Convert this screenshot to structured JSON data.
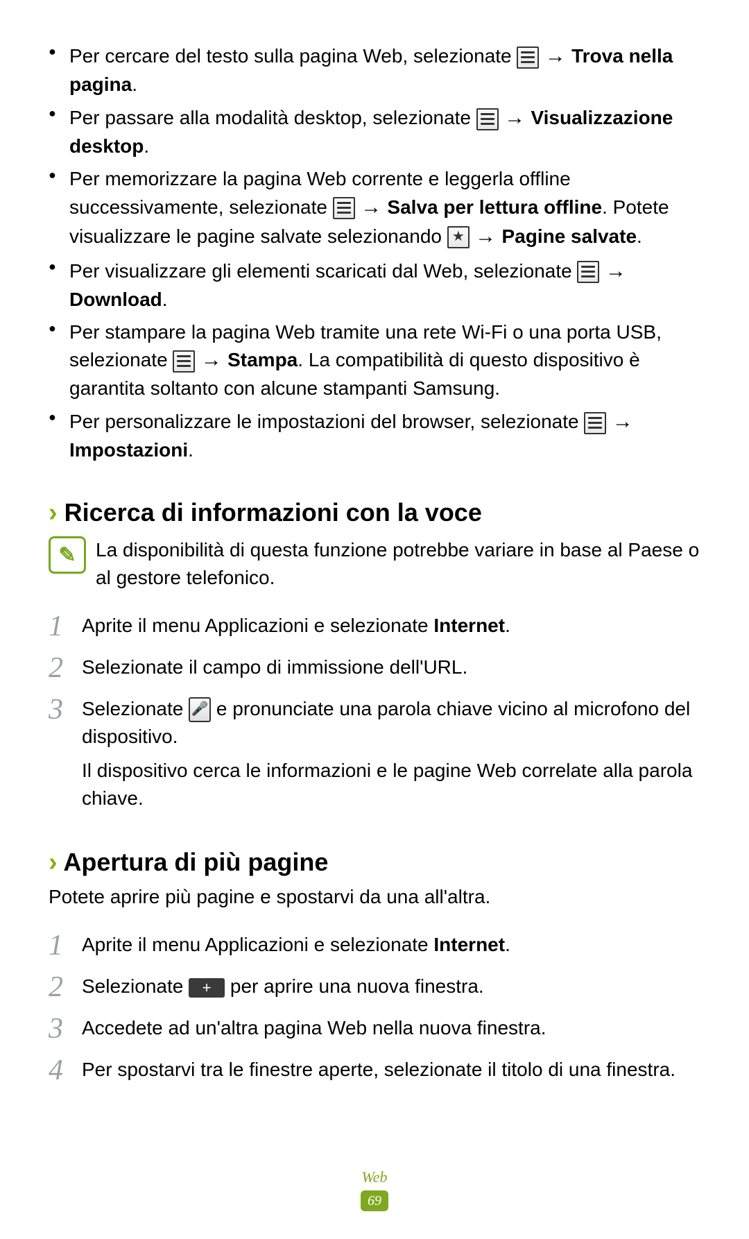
{
  "bullets": [
    {
      "pre": "Per cercare del testo sulla pagina Web, selezionate ",
      "icon1": "menu",
      "mid": " → ",
      "bold": "Trova nella pagina",
      "post": "."
    },
    {
      "pre": "Per passare alla modalità desktop, selezionate ",
      "icon1": "menu",
      "mid": " → ",
      "bold": "Visualizzazione desktop",
      "post": "."
    },
    {
      "pre": "Per memorizzare la pagina Web corrente e leggerla offline successivamente, selezionate ",
      "icon1": "menu",
      "mid": " → ",
      "bold": "Salva per lettura offline",
      "post": ". Potete visualizzare le pagine salvate selezionando ",
      "icon2": "star",
      "mid2": " → ",
      "bold2": "Pagine salvate",
      "post2": "."
    },
    {
      "pre": "Per visualizzare gli elementi scaricati dal Web, selezionate ",
      "icon1": "menu",
      "mid": " → ",
      "bold": "Download",
      "post": "."
    },
    {
      "pre": "Per stampare la pagina Web tramite una rete Wi-Fi o una porta USB, selezionate ",
      "icon1": "menu",
      "mid": " → ",
      "bold": "Stampa",
      "post": ". La compatibilità di questo dispositivo è garantita soltanto con alcune stampanti Samsung."
    },
    {
      "pre": "Per personalizzare le impostazioni del browser, selezionate ",
      "icon1": "menu",
      "mid": " → ",
      "bold": "Impostazioni",
      "post": "."
    }
  ],
  "section1": {
    "title": "Ricerca di informazioni con la voce",
    "note": "La disponibilità di questa funzione potrebbe variare in base al Paese o al gestore telefonico.",
    "steps": [
      {
        "num": "1",
        "pre": "Aprite il menu Applicazioni e selezionate ",
        "bold": "Internet",
        "post": "."
      },
      {
        "num": "2",
        "pre": "Selezionate il campo di immissione dell'URL."
      },
      {
        "num": "3",
        "pre": "Selezionate ",
        "icon": "mic",
        "post": " e pronunciate una parola chiave vicino al microfono del dispositivo.",
        "sub": "Il dispositivo cerca le informazioni e le pagine Web correlate alla parola chiave."
      }
    ]
  },
  "section2": {
    "title": "Apertura di più pagine",
    "intro": "Potete aprire più pagine e spostarvi da una all'altra.",
    "steps": [
      {
        "num": "1",
        "pre": "Aprite il menu Applicazioni e selezionate ",
        "bold": "Internet",
        "post": "."
      },
      {
        "num": "2",
        "pre": "Selezionate ",
        "icon": "plus",
        "post": " per aprire una nuova finestra."
      },
      {
        "num": "3",
        "pre": "Accedete ad un'altra pagina Web nella nuova finestra."
      },
      {
        "num": "4",
        "pre": "Per spostarvi tra le finestre aperte, selezionate il titolo di una finestra."
      }
    ]
  },
  "footer": {
    "section": "Web",
    "page": "69"
  }
}
